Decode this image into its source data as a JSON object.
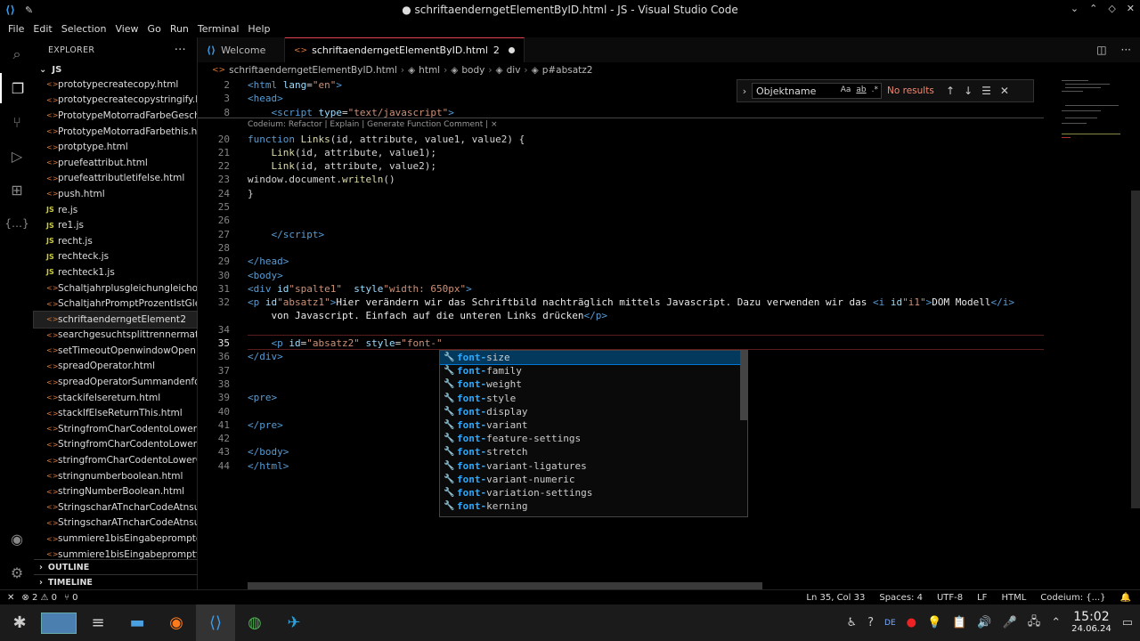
{
  "window": {
    "title": "● schriftaenderngetElementByID.html - JS - Visual Studio Code",
    "controls": [
      "⌄",
      "⌃",
      "◇",
      "✕"
    ]
  },
  "menu": [
    "File",
    "Edit",
    "Selection",
    "View",
    "Go",
    "Run",
    "Terminal",
    "Help"
  ],
  "activity": [
    "files-icon",
    "search-icon",
    "source-control-icon",
    "run-debug-icon",
    "extensions-icon",
    "json-icon",
    "account-icon",
    "settings-icon"
  ],
  "sidebar": {
    "title": "EXPLORER",
    "more": "···",
    "folder": "JS",
    "files": [
      {
        "name": "prototypecreatecopy.html",
        "type": "html"
      },
      {
        "name": "prototypecreatecopystringify.ht...",
        "type": "html"
      },
      {
        "name": "PrototypeMotorradFarbeGesch...",
        "type": "html"
      },
      {
        "name": "PrototypeMotorradFarbethis.ht...",
        "type": "html"
      },
      {
        "name": "protptype.html",
        "type": "html"
      },
      {
        "name": "pruefeattribut.html",
        "type": "html"
      },
      {
        "name": "pruefeattributletifelse.html",
        "type": "html"
      },
      {
        "name": "push.html",
        "type": "html"
      },
      {
        "name": "re.js",
        "type": "js"
      },
      {
        "name": "re1.js",
        "type": "js"
      },
      {
        "name": "recht.js",
        "type": "js"
      },
      {
        "name": "rechteck.js",
        "type": "js"
      },
      {
        "name": "rechteck1.js",
        "type": "js"
      },
      {
        "name": "Schaltjahrplusgleichungleichod...",
        "type": "html"
      },
      {
        "name": "SchaltjahrPromptProzentIstGlei...",
        "type": "html"
      },
      {
        "name": "schriftaenderngetElement...",
        "type": "html",
        "badge": "2",
        "selected": true
      },
      {
        "name": "searchgesuchtsplittrennermatc...",
        "type": "html"
      },
      {
        "name": "setTimeoutOpenwindowOpen...",
        "type": "html"
      },
      {
        "name": "spreadOperator.html",
        "type": "html"
      },
      {
        "name": "spreadOperatorSummandenfor...",
        "type": "html"
      },
      {
        "name": "stackifelsereturn.html",
        "type": "html"
      },
      {
        "name": "stackIfElseReturnThis.html",
        "type": "html"
      },
      {
        "name": "StringfromCharCodentoLowerC...",
        "type": "html"
      },
      {
        "name": "StringfromCharCodentoLowerC...",
        "type": "html"
      },
      {
        "name": "stringfromCharCodentoLowerC...",
        "type": "html"
      },
      {
        "name": "stringnumberboolean.html",
        "type": "html"
      },
      {
        "name": "stringNumberBoolean.html",
        "type": "html"
      },
      {
        "name": "StringscharATncharCodeAtnsub...",
        "type": "html"
      },
      {
        "name": "StringscharATncharCodeAtnsub...",
        "type": "html"
      },
      {
        "name": "summiere1bisEingabepromptd...",
        "type": "html"
      },
      {
        "name": "summiere1bisEingabepromptfo...",
        "type": "html"
      }
    ],
    "outline": "OUTLINE",
    "timeline": "TIMELINE"
  },
  "tabs": [
    {
      "label": "Welcome",
      "active": false
    },
    {
      "label": "schriftaenderngetElementByID.html",
      "badge": "2",
      "active": true
    }
  ],
  "breadcrumb": [
    "schriftaenderngetElementByID.html",
    "html",
    "body",
    "div",
    "p#absatz2"
  ],
  "codelens": "Codeium: Refactor | Explain | Generate Function Comment | ×",
  "code": {
    "sticky": [
      {
        "n": "2",
        "html": "<span class='tag'>&lt;html</span> <span class='attr'>lang</span>=<span class='str'>\"en\"</span><span class='tag'>&gt;</span>"
      },
      {
        "n": "3",
        "html": "<span class='tag'>&lt;head&gt;</span>"
      },
      {
        "n": "8",
        "html": "    <span class='tag'>&lt;script</span> <span class='attr'>type</span>=<span class='str'>\"text/javascript\"</span><span class='tag'>&gt;</span>"
      }
    ],
    "lines": [
      {
        "n": "20",
        "html": "<span class='kw'>function</span> <span class='fn'>Links</span>(id, attribute, value1, value2) {"
      },
      {
        "n": "21",
        "html": "    <span class='fn'>Link</span>(id, attribute, value1);"
      },
      {
        "n": "22",
        "html": "    <span class='fn'>Link</span>(id, attribute, value2);"
      },
      {
        "n": "23",
        "html": "window.document.<span class='fn'>writeln</span>()"
      },
      {
        "n": "24",
        "html": "}"
      },
      {
        "n": "25",
        "html": ""
      },
      {
        "n": "26",
        "html": ""
      },
      {
        "n": "27",
        "html": "    <span class='tag'>&lt;/script&gt;</span>"
      },
      {
        "n": "28",
        "html": ""
      },
      {
        "n": "29",
        "html": "<span class='tag'>&lt;/head&gt;</span>"
      },
      {
        "n": "30",
        "html": "<span class='tag'>&lt;body&gt;</span>"
      },
      {
        "n": "31",
        "html": "<span class='tag'>&lt;div</span> <span class='attr'>id</span><span class='str'>\"spalte1\"</span>  <span class='attr'>style</span><span class='str'>\"width: 650px\"</span><span class='tag'>&gt;</span>"
      },
      {
        "n": "32",
        "html": "<span class='tag'>&lt;p</span> <span class='attr'>id</span><span class='str'>\"absatz1\"</span><span class='tag'>&gt;</span><span class='tx'>Hier verändern wir das Schriftbild nachträglich mittels Javascript. Dazu verwenden wir das </span><span class='tag'>&lt;i</span> <span class='attr'>id</span><span class='str'>\"i1\"</span><span class='tag'>&gt;</span><span class='tx'>DOM Modell</span><span class='tag'>&lt;/i&gt;</span>"
      },
      {
        "n": "",
        "html": "    <span class='tx'>von Javascript. Einfach auf die unteren Links drücken</span><span class='tag'>&lt;/p&gt;</span>"
      },
      {
        "n": "34",
        "html": ""
      },
      {
        "n": "35",
        "html": "    <span class='tag'>&lt;p</span> <span class='attr'>id</span>=<span class='str'>\"absatz2\"</span> <span class='attr'>style</span>=<span class='str'>\"font-\"</span>",
        "current": true
      },
      {
        "n": "36",
        "html": "<span class='tag'>&lt;/div&gt;</span>"
      },
      {
        "n": "37",
        "html": ""
      },
      {
        "n": "38",
        "html": ""
      },
      {
        "n": "39",
        "html": "<span class='tag'>&lt;pre&gt;</span>"
      },
      {
        "n": "40",
        "html": ""
      },
      {
        "n": "41",
        "html": "<span class='tag'>&lt;/pre&gt;</span>"
      },
      {
        "n": "42",
        "html": ""
      },
      {
        "n": "43",
        "html": "<span class='tag'>&lt;/body&gt;</span>"
      },
      {
        "n": "44",
        "html": "<span class='tag'>&lt;/html&gt;</span>"
      }
    ]
  },
  "find": {
    "value": "Objektname",
    "case_label": "Aa",
    "word_label": "ab",
    "regex_label": ".*",
    "result": "No results"
  },
  "suggest": {
    "match": "font-",
    "items": [
      "size",
      "family",
      "weight",
      "style",
      "display",
      "variant",
      "feature-settings",
      "stretch",
      "variant-ligatures",
      "variant-numeric",
      "variation-settings",
      "kerning"
    ]
  },
  "status": {
    "errors": "⊗ 2 ⚠ 0",
    "ports": "⑂ 0",
    "position": "Ln 35, Col 33",
    "spaces": "Spaces: 4",
    "encoding": "UTF-8",
    "eol": "LF",
    "language": "HTML",
    "codeium": "Codeium: {...}"
  },
  "taskbar": {
    "time": "15:02",
    "date": "24.06.24",
    "lang": "DE"
  }
}
